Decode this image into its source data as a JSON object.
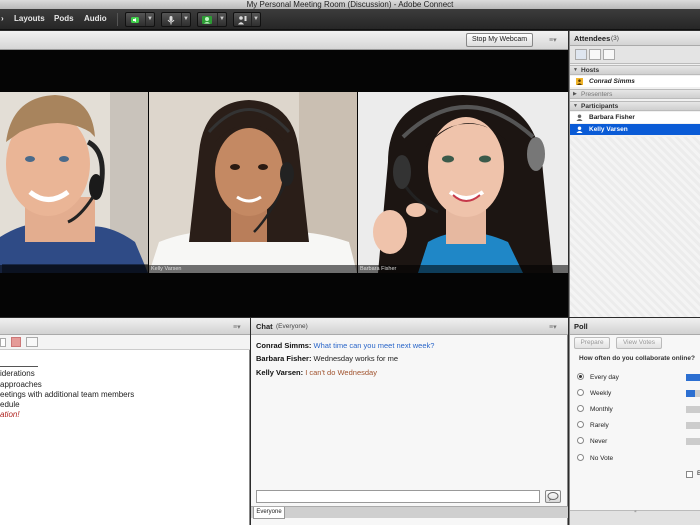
{
  "window": {
    "title": "My Personal Meeting Room (Discussion) - Adobe Connect"
  },
  "menubar": {
    "items": [
      "Layouts",
      "Pods",
      "Audio"
    ]
  },
  "video": {
    "stop_webcam_label": "Stop My Webcam",
    "cams": [
      {
        "label": ""
      },
      {
        "label": "Kelly Varsen"
      },
      {
        "label": "Barbara Fisher"
      }
    ]
  },
  "attendees": {
    "title": "Attendees",
    "count": "(3)",
    "groups": {
      "hosts": "Hosts",
      "presenters": "Presenters",
      "participants": "Participants"
    },
    "hosts": [
      "Conrad Simms"
    ],
    "participants": [
      "Barbara Fisher",
      "Kelly Varsen"
    ]
  },
  "notes": {
    "lines": [
      "iderations",
      "approaches",
      "eetings with additional team members",
      "edule",
      "ation!"
    ]
  },
  "chat": {
    "title": "Chat",
    "scope": "(Everyone)",
    "messages": [
      {
        "sender": "Conrad Simms:",
        "text": "What time can you meet next week?",
        "color": "#2a66c9"
      },
      {
        "sender": "Barbara Fisher:",
        "text": "Wednesday works for me",
        "color": "#222222"
      },
      {
        "sender": "Kelly Varsen:",
        "text": "I can't do Wednesday",
        "color": "#a0522d"
      }
    ],
    "tab_label": "Everyone"
  },
  "poll": {
    "title": "Poll",
    "prepare_label": "Prepare",
    "view_votes_label": "View Votes",
    "question": "How often do you collaborate online?",
    "options": [
      {
        "label": "Every day",
        "selected": true,
        "share": 1.0
      },
      {
        "label": "Weekly",
        "selected": false,
        "share": 0.6
      },
      {
        "label": "Monthly",
        "selected": false,
        "share": 0.0
      },
      {
        "label": "Rarely",
        "selected": false,
        "share": 0.0
      },
      {
        "label": "Never",
        "selected": false,
        "share": 0.0
      },
      {
        "label": "No Vote",
        "selected": false,
        "share": null
      }
    ],
    "checkbox_label": "B"
  },
  "colors": {
    "selected_row": "#0a5bd6",
    "poll_bar": "#2c6fd1",
    "speaking_icon": "#3fcf4a"
  },
  "icons": [
    "speaker-icon",
    "microphone-icon",
    "webcam-icon",
    "raise-hand-icon",
    "pod-menu-icon",
    "send-icon"
  ]
}
